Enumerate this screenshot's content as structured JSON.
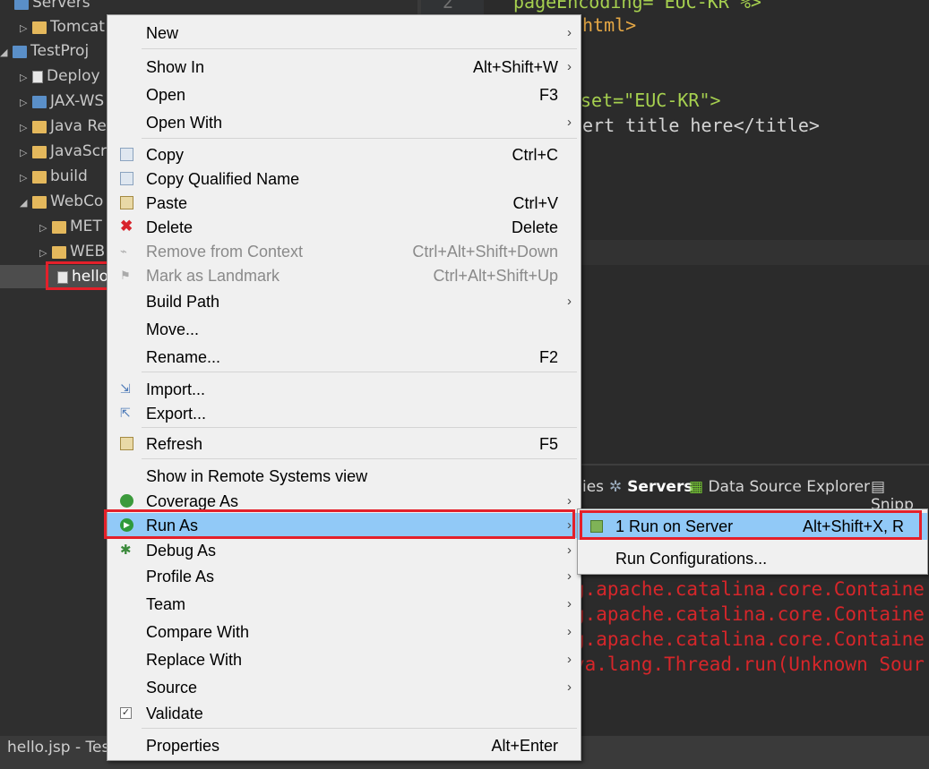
{
  "explorer": {
    "rows": [
      {
        "label": "Servers",
        "icon": "folder-icon"
      },
      {
        "label": "Tomcat",
        "icon": "folder-icon"
      },
      {
        "label": "TestProj",
        "icon": "project-icon"
      },
      {
        "label": "Deploy",
        "icon": "deploy-icon"
      },
      {
        "label": "JAX-WS",
        "icon": "webservice-icon"
      },
      {
        "label": "Java Re",
        "icon": "library-icon"
      },
      {
        "label": "JavaScr",
        "icon": "javascript-icon"
      },
      {
        "label": "build",
        "icon": "folder-icon"
      },
      {
        "label": "WebCo",
        "icon": "folder-icon"
      },
      {
        "label": "MET",
        "icon": "folder-icon"
      },
      {
        "label": "WEB",
        "icon": "folder-icon"
      },
      {
        "label": "hello",
        "icon": "jsp-file-icon"
      }
    ]
  },
  "editor": {
    "line_number": "2",
    "lines": [
      "pageEncoding=\"EUC-KR\"%>",
      "html>",
      "set=\"EUC-KR\">",
      "ert title here</title>"
    ]
  },
  "console": {
    "tabs": [
      {
        "label": "ies",
        "icon": ""
      },
      {
        "label": "Servers",
        "icon": "servers-icon"
      },
      {
        "label": "Data Source Explorer",
        "icon": "data-source-icon"
      },
      {
        "label": "Snipp",
        "icon": "snippets-icon"
      }
    ],
    "lines": [
      "g.apache.catalina.core.Containe",
      "g.apache.catalina.core.Containe",
      "g.apache.catalina.core.Containe",
      "va.lang.Thread.run(Unknown Sour"
    ]
  },
  "statusbar": {
    "text": "hello.jsp - Tes"
  },
  "context_menu": {
    "items": [
      {
        "label": "New",
        "shortcut": "",
        "submenu": true
      },
      {
        "label": "Show In",
        "shortcut": "Alt+Shift+W",
        "submenu": true
      },
      {
        "label": "Open",
        "shortcut": "F3",
        "submenu": false
      },
      {
        "label": "Open With",
        "shortcut": "",
        "submenu": true
      },
      {
        "label": "Copy",
        "shortcut": "Ctrl+C",
        "submenu": false
      },
      {
        "label": "Copy Qualified Name",
        "shortcut": "",
        "submenu": false
      },
      {
        "label": "Paste",
        "shortcut": "Ctrl+V",
        "submenu": false
      },
      {
        "label": "Delete",
        "shortcut": "Delete",
        "submenu": false
      },
      {
        "label": "Remove from Context",
        "shortcut": "Ctrl+Alt+Shift+Down",
        "submenu": false
      },
      {
        "label": "Mark as Landmark",
        "shortcut": "Ctrl+Alt+Shift+Up",
        "submenu": false
      },
      {
        "label": "Build Path",
        "shortcut": "",
        "submenu": true
      },
      {
        "label": "Move...",
        "shortcut": "",
        "submenu": false
      },
      {
        "label": "Rename...",
        "shortcut": "F2",
        "submenu": false
      },
      {
        "label": "Import...",
        "shortcut": "",
        "submenu": false
      },
      {
        "label": "Export...",
        "shortcut": "",
        "submenu": false
      },
      {
        "label": "Refresh",
        "shortcut": "F5",
        "submenu": false
      },
      {
        "label": "Show in Remote Systems view",
        "shortcut": "",
        "submenu": false
      },
      {
        "label": "Coverage As",
        "shortcut": "",
        "submenu": true
      },
      {
        "label": "Run As",
        "shortcut": "",
        "submenu": true
      },
      {
        "label": "Debug As",
        "shortcut": "",
        "submenu": true
      },
      {
        "label": "Profile As",
        "shortcut": "",
        "submenu": true
      },
      {
        "label": "Team",
        "shortcut": "",
        "submenu": true
      },
      {
        "label": "Compare With",
        "shortcut": "",
        "submenu": true
      },
      {
        "label": "Replace With",
        "shortcut": "",
        "submenu": true
      },
      {
        "label": "Source",
        "shortcut": "",
        "submenu": true
      },
      {
        "label": "Validate",
        "shortcut": "",
        "submenu": false
      },
      {
        "label": "Properties",
        "shortcut": "Alt+Enter",
        "submenu": false
      }
    ],
    "arrow": "›"
  },
  "run_as_submenu": {
    "items": [
      {
        "label": "1 Run on Server",
        "shortcut": "Alt+Shift+X, R"
      },
      {
        "label": "Run Configurations...",
        "shortcut": ""
      }
    ]
  },
  "colors": {
    "highlight": "#91c9f7",
    "annotation_red": "#e4202a",
    "console_error": "#d6262a"
  }
}
